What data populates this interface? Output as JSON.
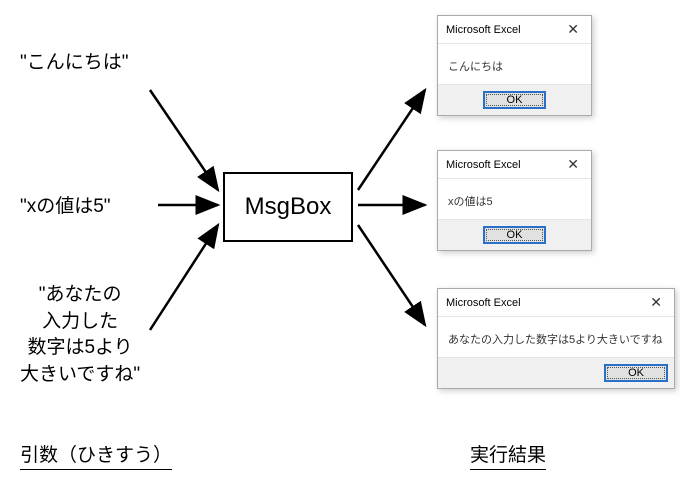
{
  "inputs": {
    "text1": "\"こんにちは\"",
    "text2": "\"xの値は5\"",
    "text3_line1": "\"あなたの",
    "text3_line2": "入力した",
    "text3_line3": "数字は5より",
    "text3_line4": "大きいですね\""
  },
  "function": {
    "name": "MsgBox"
  },
  "dialogs": {
    "title": "Microsoft Excel",
    "ok_label": "OK",
    "body1": "こんにちは",
    "body2": "xの値は5",
    "body3": "あなたの入力した数字は5より大きいですね"
  },
  "captions": {
    "arguments": "引数（ひきすう）",
    "results": "実行結果"
  }
}
